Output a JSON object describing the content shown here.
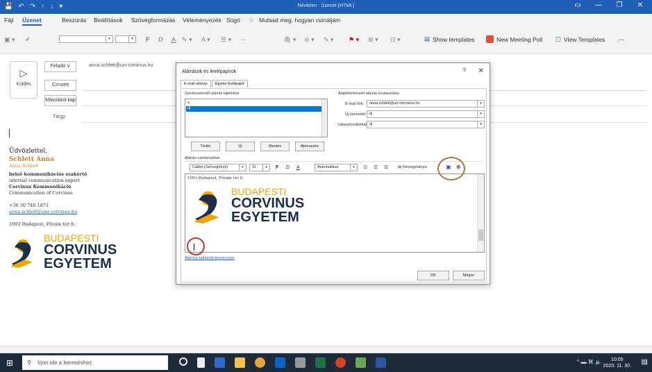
{
  "window": {
    "title": "Névtelen - Üzenet (HTML)",
    "quick_access": [
      "💾",
      "↶",
      "↷",
      "↑",
      "↓",
      "▾"
    ],
    "controls": [
      "▭",
      "—",
      "❐",
      "✕"
    ]
  },
  "menu": {
    "items": [
      "Fájl",
      "Üzenet",
      "Beszúrás",
      "Beállítások",
      "Szövegformázás",
      "Véleményezés",
      "Súgó"
    ],
    "active": "Üzenet",
    "tell_me": "Mutasd meg, hogyan csináljam"
  },
  "ribbon": {
    "format_glyphs": [
      "F",
      "D",
      "A"
    ],
    "show_templates": "Show templates",
    "new_meeting_poll": "New Meeting Poll",
    "view_templates": "View Templates",
    "more": "···"
  },
  "compose": {
    "send_label": "Küldés",
    "from_button": "Feladó ∨",
    "from_value": "anna.schlett@uni-corvinus.hu",
    "to_button": "Címzett",
    "cc_button": "Másolatot kap",
    "subject_label": "Tárgy"
  },
  "signature": {
    "greeting": "Üdvözlettel,",
    "name": "Schlett Anna",
    "name_small": "Anna Schlett",
    "title_hu": "belső kommunikációs szakértő",
    "title_en": "internal communication expert",
    "dept_hu": "Corvinus Kommunikáció",
    "dept_en": "Communication of Corvinus",
    "phone": "+36 30 740 1871",
    "email": "anna.schlett@uni-corvinus.hu",
    "address": "1093 Budapest, Fővám tér 8.",
    "logo": [
      "BUDAPESTI",
      "CORVINUS",
      "EGYETEM"
    ]
  },
  "dialog": {
    "title": "Aláírások és levélpapírok",
    "help": "?",
    "close": "✕",
    "tabs": [
      "E-mail aláírás",
      "Egyéni levélpapír"
    ],
    "select_label": "Szerkesztendő aláírás kijelölése",
    "list": [
      "a",
      "új"
    ],
    "buttons": [
      "Törlés",
      "Új",
      "Mentés",
      "Átnevezés"
    ],
    "default_label": "Alapértelmezett aláírás kiválasztása",
    "account_label": "E-mail fiók:",
    "account_value": "anna.schlett@uni-corvinus.hu",
    "new_msg_label": "Új üzenetek:",
    "new_msg_value": "új",
    "reply_label": "Válasz/továbbítás:",
    "reply_value": "új",
    "edit_label": "Aláírás szerkesztése",
    "font": "Calibri (Szövegtörzs)",
    "size": "11",
    "color": "Automatikus",
    "business_card": "Névjegykártya",
    "editor_address": "1093 Budapest, Fővám tér 8.",
    "templates_link": "Aláírási sablonok beszerzése",
    "ok": "OK",
    "cancel": "Mégse"
  },
  "taskbar": {
    "search_placeholder": "Írjon ide a kereséshez",
    "time": "10:05",
    "date": "2020. 11. 30.",
    "tray": "^ ▬ ⌘ 🔈"
  },
  "colors": {
    "accent": "#1f5fb5",
    "corvinus_orange": "#f0a500",
    "corvinus_navy": "#1b2e4a",
    "signature_orange": "#c9832a",
    "highlight_circle_red": "#c0392b",
    "highlight_circle_brown": "#a0784a"
  }
}
